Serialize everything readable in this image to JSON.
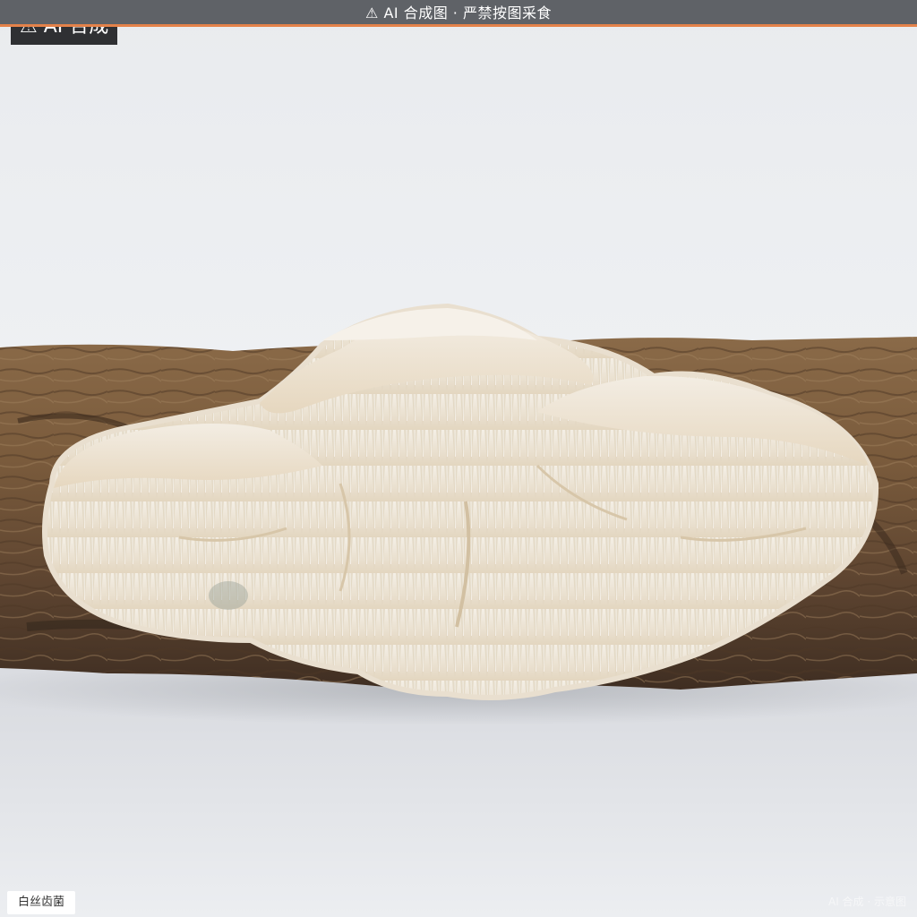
{
  "banner": {
    "icon": "warning-icon",
    "text": "AI 合成图 · 严禁按图采食",
    "background": "#5f6267",
    "accent": "#e4824a"
  },
  "badge": {
    "icon": "warning-icon",
    "text": "AI 合成"
  },
  "caption": {
    "species": "白丝齿菌"
  },
  "watermark": {
    "text": "AI 合成 · 示意图"
  },
  "scene": {
    "subject": "fungus-on-log",
    "background_color": "#eceef1",
    "fungus_color": "#efe6d6",
    "log_color": "#7a5c3e"
  }
}
